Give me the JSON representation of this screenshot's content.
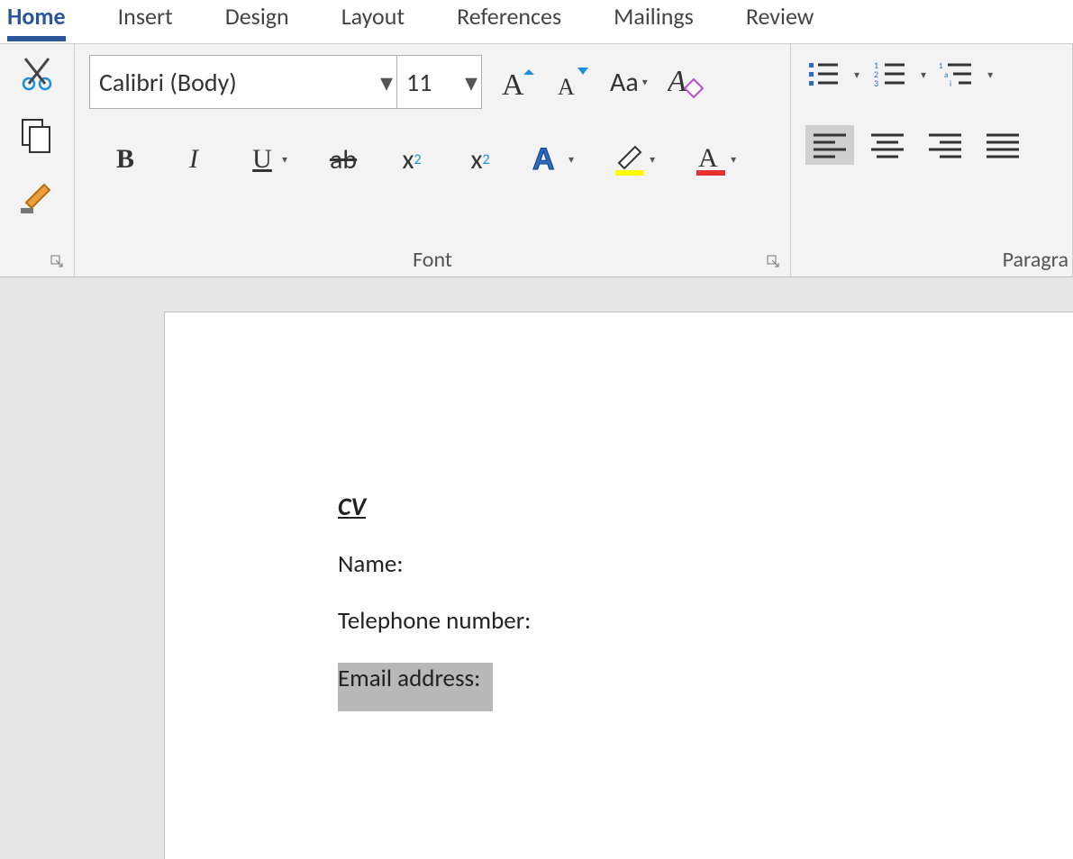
{
  "tabs": {
    "home": "Home",
    "insert": "Insert",
    "design": "Design",
    "layout": "Layout",
    "references": "References",
    "mailings": "Mailings",
    "review": "Review"
  },
  "font": {
    "name": "Calibri (Body)",
    "size": "11",
    "group_label": "Font"
  },
  "paragraph": {
    "group_label": "Paragra"
  },
  "document": {
    "title": "CV",
    "line_name": "Name:",
    "line_phone": "Telephone number:",
    "line_email": "Email address:"
  }
}
